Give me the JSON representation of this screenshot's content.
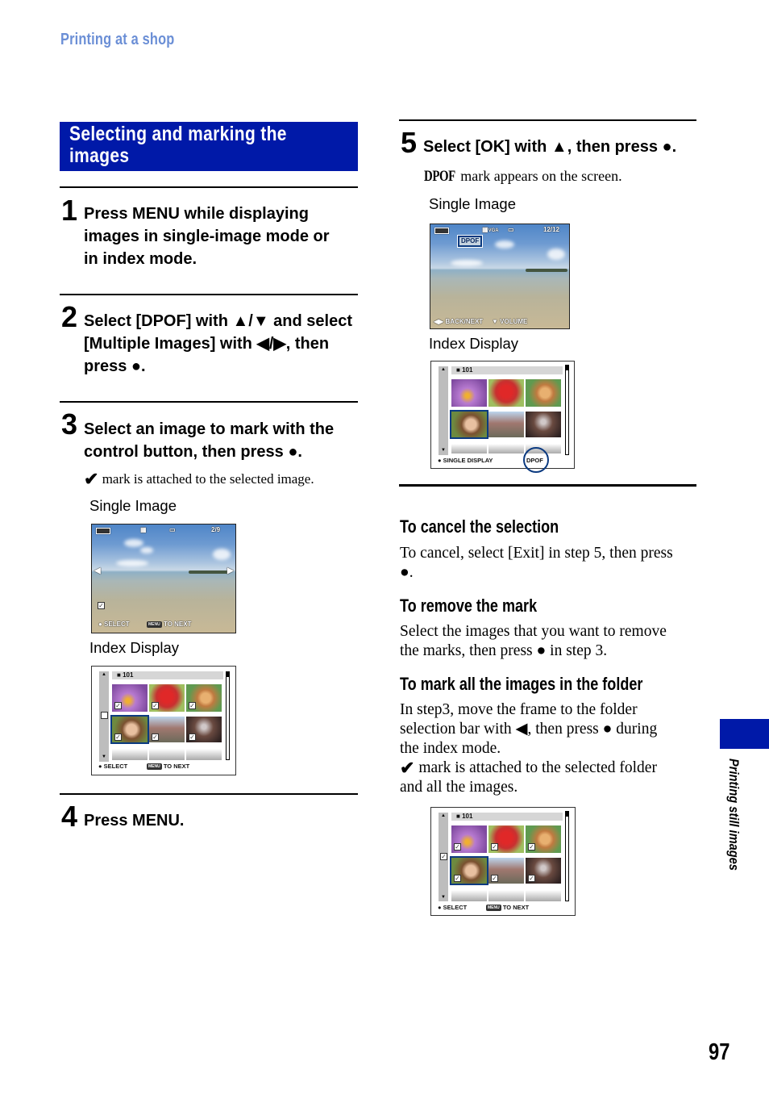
{
  "header": {
    "breadcrumb": "Printing at a shop"
  },
  "section": {
    "title_line1": "Selecting and marking the",
    "title_line2": "images"
  },
  "steps": [
    {
      "number": "1",
      "lines": [
        "Press MENU while displaying",
        "images in single-image mode or",
        "in index mode."
      ]
    },
    {
      "number": "2",
      "lines": [
        "Select [DPOF] with ▲/▼ and select",
        "[Multiple Images] with ◀/▶, then",
        "press ●."
      ]
    },
    {
      "number": "3",
      "lines": [
        "Select an image to mark with the",
        "control button, then press ●."
      ],
      "note_icon": "check-mark-icon",
      "note": "mark is attached to the selected image.",
      "single_image_label": "Single Image",
      "index_display_label": "Index Display"
    },
    {
      "number": "4",
      "lines": [
        "Press MENU."
      ]
    },
    {
      "number": "5",
      "lines": [
        "Select [OK] with ▲, then press ●."
      ],
      "note_icon": "dpof-mark-icon",
      "note_glyph": "DPOF",
      "note": "mark appears on the screen.",
      "single_image_label": "Single Image",
      "index_display_label": "Index Display"
    }
  ],
  "screens": {
    "step3_single": {
      "counter": "2/9",
      "footer_left": "● SELECT",
      "footer_menu": "MENU",
      "footer_right": "TO NEXT",
      "checked": true
    },
    "step3_index": {
      "folder": "101",
      "footer_left": "● SELECT",
      "footer_menu": "MENU",
      "footer_right": "TO NEXT",
      "folder_checked": false,
      "thumbs": [
        {
          "name": "purple-flower",
          "checked": true
        },
        {
          "name": "red-flower",
          "checked": true
        },
        {
          "name": "dog",
          "checked": true
        },
        {
          "name": "child-portrait",
          "checked": true,
          "selected": true
        },
        {
          "name": "two-girls",
          "checked": true
        },
        {
          "name": "night-tree",
          "checked": true
        }
      ]
    },
    "step5_single": {
      "counter": "12/12",
      "badge": "DPOF",
      "quality": "VGA",
      "footer_left": "◀▶ BACK/NEXT",
      "footer_right": "▼ VOLUME"
    },
    "step5_index": {
      "folder": "101",
      "footer_left": "● SINGLE DISPLAY",
      "footer_right": "DPOF",
      "thumbs": [
        {
          "name": "purple-flower"
        },
        {
          "name": "red-flower"
        },
        {
          "name": "dog"
        },
        {
          "name": "child-portrait",
          "selected": true
        },
        {
          "name": "two-girls"
        },
        {
          "name": "night-tree"
        }
      ]
    },
    "folder_index": {
      "folder": "101",
      "footer_left": "● SELECT",
      "footer_menu": "MENU",
      "footer_right": "TO NEXT",
      "folder_checked": true
    }
  },
  "tips": [
    {
      "heading": "To cancel the selection",
      "lines": [
        "To cancel, select [Exit] in step 5, then press",
        "●."
      ]
    },
    {
      "heading": "To remove the mark",
      "lines": [
        "Select the images that you want to remove",
        "the marks, then press ● in step 3."
      ]
    },
    {
      "heading": "To mark all the images in the folder",
      "lines": [
        "In step3, move the frame to the folder",
        "selection bar with ◀, then press ● during",
        "the index mode."
      ],
      "note_icon": "check-mark-icon",
      "note_lines": [
        "mark is attached to the selected folder",
        "and all the images."
      ]
    }
  ],
  "sidebar": {
    "chapter": "Printing still images",
    "tab_color": "#0019a8"
  },
  "footer": {
    "page_number": "97"
  },
  "colors": {
    "accent_blue": "#0019a8",
    "header_blue": "#6b8fd6",
    "selection_frame": "#0b3a80"
  }
}
